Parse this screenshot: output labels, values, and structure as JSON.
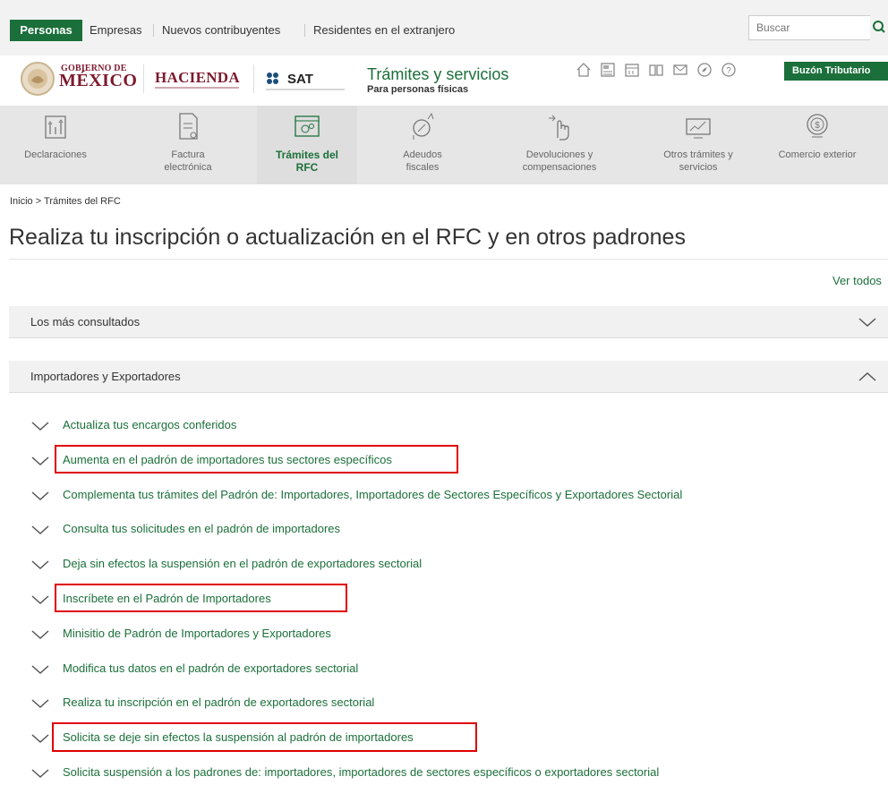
{
  "topbar": {
    "active_tab": "Personas",
    "links": [
      "Empresas",
      "Nuevos contribuyentes",
      "Residentes en el extranjero"
    ],
    "search_placeholder": "Buscar"
  },
  "brand": {
    "gob_small": "GOBIERNO DE",
    "gob_big": "MÉXICO",
    "hacienda": "HACIENDA",
    "sat": "SAT",
    "portal_title": "Trámites y servicios",
    "portal_subtitle": "Para personas físicas",
    "header_icons": [
      "home-icon",
      "calculator-icon",
      "calendar-icon",
      "book-icon",
      "mail-icon",
      "compass-icon",
      "help-icon"
    ],
    "buzon_label": "Buzón Tributario"
  },
  "nav": {
    "items": [
      {
        "label": "Declaraciones",
        "icon": "declaraciones-icon"
      },
      {
        "label": "Factura electrónica",
        "icon": "factura-icon"
      },
      {
        "label": "Trámites del RFC",
        "icon": "rfc-icon",
        "active": true
      },
      {
        "label": "Adeudos fiscales",
        "icon": "adeudos-icon"
      },
      {
        "label": "Devoluciones y compensaciones",
        "icon": "devoluciones-icon"
      },
      {
        "label": "Otros trámites y servicios",
        "icon": "otros-tramites-icon"
      },
      {
        "label": "Comercio exterior",
        "icon": "comercio-exterior-icon"
      }
    ]
  },
  "breadcrumb": "Inicio > Trámites del RFC",
  "page_title": "Realiza tu inscripción o actualización en el RFC y en otros padrones",
  "ver_todos": "Ver todos",
  "sections": [
    {
      "label": "Los más consultados",
      "expanded": false
    },
    {
      "label": "Importadores y Exportadores",
      "expanded": true
    }
  ],
  "items": [
    "Actualiza tus encargos conferidos",
    "Aumenta en el padrón de importadores tus sectores específicos",
    "Complementa tus trámites del Padrón de: Importadores, Importadores de Sectores Específicos y Exportadores Sectorial",
    "Consulta tus solicitudes en el padrón de importadores",
    "Deja sin efectos la suspensión en el padrón de exportadores sectorial",
    "Inscríbete en el Padrón de Importadores",
    "Minisitio de Padrón de Importadores y Exportadores",
    "Modifica tus datos en el padrón de exportadores sectorial",
    "Realiza tu inscripción en el padrón de exportadores sectorial",
    "Solicita se deje sin efectos la suspensión al padrón de importadores",
    "Solicita suspensión a los padrones de: importadores, importadores de sectores específicos o exportadores sectorial"
  ],
  "colors": {
    "brand_green": "#1b6f3a",
    "gob_maroon": "#7d1a2e",
    "highlight_red": "#e00000"
  }
}
